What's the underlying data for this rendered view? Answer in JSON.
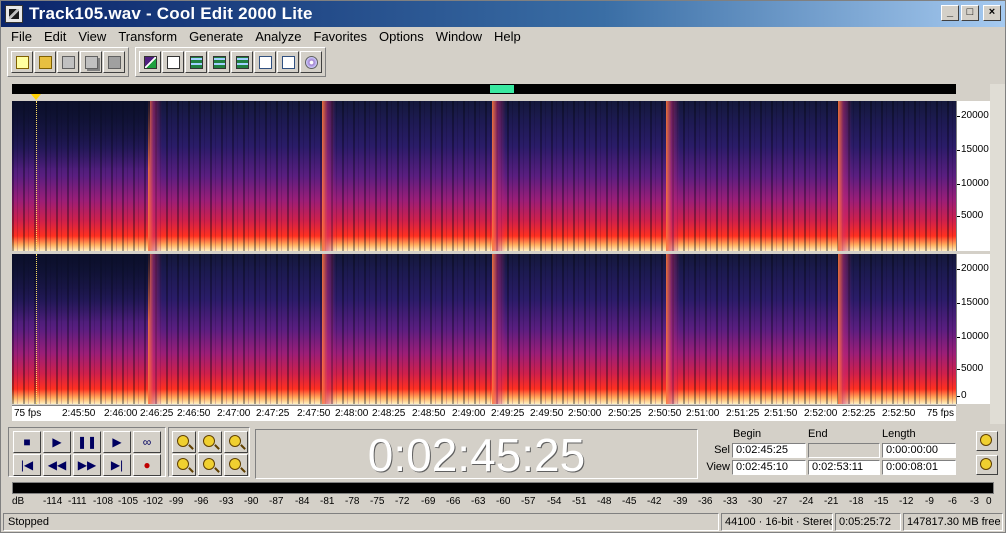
{
  "window": {
    "title": "Track105.wav - Cool Edit 2000 Lite",
    "controls": {
      "minimize": "_",
      "maximize": "□",
      "close": "×"
    }
  },
  "menu": [
    "File",
    "Edit",
    "View",
    "Transform",
    "Generate",
    "Analyze",
    "Favorites",
    "Options",
    "Window",
    "Help"
  ],
  "toolbar": {
    "file_icons": [
      "new-file-icon",
      "open-file-icon",
      "save-icon",
      "save-as-icon",
      "save-all-icon"
    ],
    "view_icons": [
      "spectral-view-icon",
      "checkbox-icon",
      "grid-icon",
      "grid-icon",
      "grid-icon",
      "document-icon",
      "document-p-icon",
      "cd-icon"
    ]
  },
  "spectrogram": {
    "freq_labels": [
      "20000",
      "15000",
      "10000",
      "5000",
      "0"
    ],
    "colors": {
      "low": "#14183a",
      "mid": "#9a1e78",
      "high": "#fff0c0"
    }
  },
  "time_ruler": {
    "left_label": "75 fps",
    "right_label": "75 fps",
    "ticks": [
      "2:45:50",
      "2:46:00",
      "2:46:25",
      "2:46:50",
      "2:47:00",
      "2:47:25",
      "2:47:50",
      "2:48:00",
      "2:48:25",
      "2:48:50",
      "2:49:00",
      "2:49:25",
      "2:49:50",
      "2:50:00",
      "2:50:25",
      "2:50:50",
      "2:51:00",
      "2:51:25",
      "2:51:50",
      "2:52:00",
      "2:52:25",
      "2:52:50"
    ]
  },
  "transport": {
    "buttons": [
      {
        "name": "stop-button",
        "glyph": "■"
      },
      {
        "name": "play-button",
        "glyph": "▶"
      },
      {
        "name": "pause-button",
        "glyph": "❚❚"
      },
      {
        "name": "play-to-end-button",
        "glyph": "▶"
      },
      {
        "name": "loop-button",
        "glyph": "∞"
      },
      {
        "name": "go-to-beginning-button",
        "glyph": "|◀"
      },
      {
        "name": "rewind-button",
        "glyph": "◀◀"
      },
      {
        "name": "fast-forward-button",
        "glyph": "▶▶"
      },
      {
        "name": "go-to-end-button",
        "glyph": "▶|"
      },
      {
        "name": "record-button",
        "glyph": "●"
      }
    ]
  },
  "time_display": "0:02:45:25",
  "selection": {
    "headers": {
      "begin": "Begin",
      "end": "End",
      "length": "Length"
    },
    "sel_label": "Sel",
    "view_label": "View",
    "sel": {
      "begin": "0:02:45:25",
      "end": "",
      "length": "0:00:00:00"
    },
    "view": {
      "begin": "0:02:45:10",
      "end": "0:02:53:11",
      "length": "0:00:08:01"
    }
  },
  "level_meter": {
    "db_label": "dB",
    "ticks": [
      "-114",
      "-111",
      "-108",
      "-105",
      "-102",
      "-99",
      "-96",
      "-93",
      "-90",
      "-87",
      "-84",
      "-81",
      "-78",
      "-75",
      "-72",
      "-69",
      "-66",
      "-63",
      "-60",
      "-57",
      "-54",
      "-51",
      "-48",
      "-45",
      "-42",
      "-39",
      "-36",
      "-33",
      "-30",
      "-27",
      "-24",
      "-21",
      "-18",
      "-15",
      "-12",
      "-9",
      "-6",
      "-3",
      "0"
    ]
  },
  "status": {
    "state": "Stopped",
    "format": "44100 · 16-bit · Stereo",
    "duration": "0:05:25:72",
    "free_space": "147817.30 MB free"
  }
}
